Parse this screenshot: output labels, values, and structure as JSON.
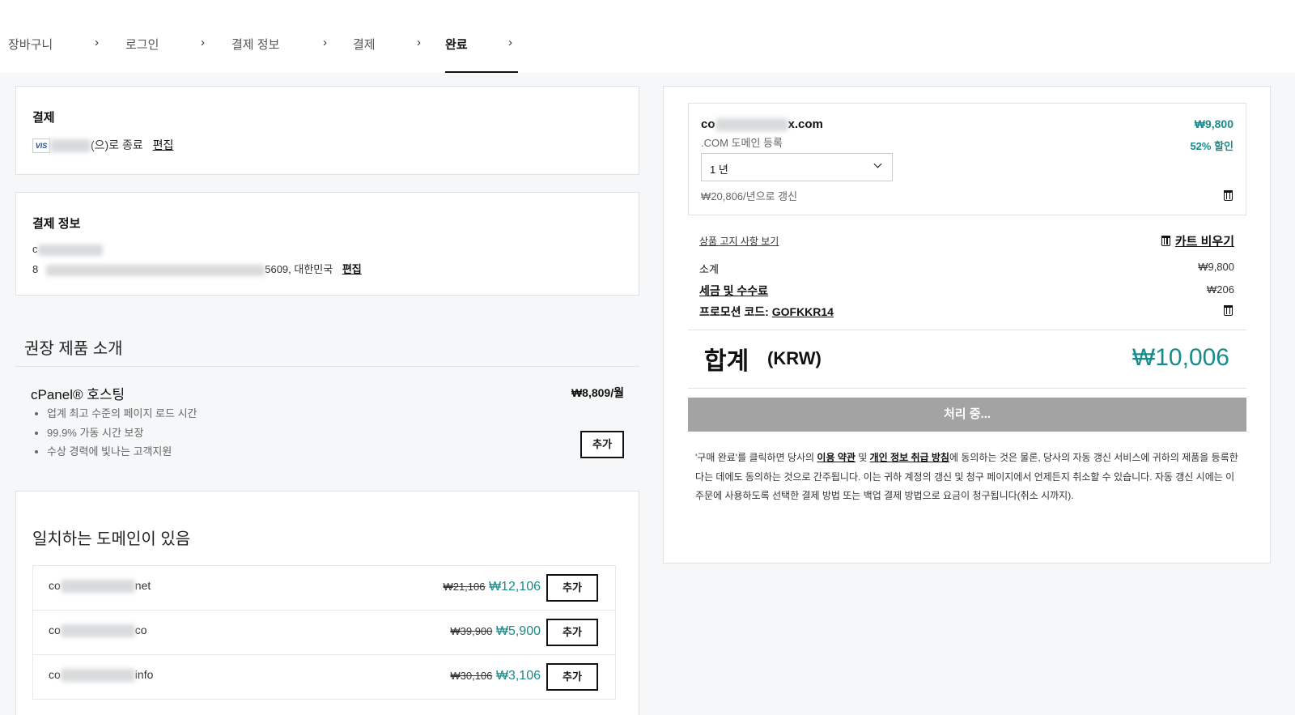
{
  "breadcrumb": {
    "steps": [
      "장바구니",
      "로그인",
      "결제 정보",
      "결제",
      "완료"
    ],
    "separator": "›"
  },
  "payment": {
    "title": "결제",
    "card_brand": "VIS",
    "card_suffix": "(으)로 종료",
    "edit_label": "편집"
  },
  "billing": {
    "title": "결제 정보",
    "name_prefix": "c",
    "address_prefix": "8",
    "address_suffix": "5609, 대한민국",
    "edit_label": "편집"
  },
  "recommended": {
    "title": "권장 제품 소개",
    "product": {
      "name": "cPanel® 호스팅",
      "price": "₩8,809/월",
      "features": [
        "업계 최고 수준의 페이지 로드 시간",
        "99.9% 가동 시간 보장",
        "수상 경력에 빛나는 고객지원"
      ],
      "add_label": "추가"
    }
  },
  "matching": {
    "title": "일치하는 도메인이 있음",
    "rows": [
      {
        "prefix": "co",
        "suffix": "net",
        "old_price": "₩21,106",
        "new_price": "₩12,106",
        "add_label": "추가"
      },
      {
        "prefix": "co",
        "suffix": "co",
        "old_price": "₩39,900",
        "new_price": "₩5,900",
        "add_label": "추가"
      },
      {
        "prefix": "co",
        "suffix": "info",
        "old_price": "₩30,106",
        "new_price": "₩3,106",
        "add_label": "추가"
      }
    ]
  },
  "cart": {
    "item": {
      "domain_prefix": "co",
      "domain_suffix": "x.com",
      "subtitle": ".COM 도메인 등록",
      "price": "₩9,800",
      "discount": "52% 할인",
      "term_value": "1 년",
      "renewal": "₩20,806/년으로 갱신"
    },
    "notice_link": "상품 고지 사항 보기",
    "empty_cart": "카트 비우기",
    "subtotal_label": "소계",
    "subtotal_value": "₩9,800",
    "tax_label": "세금 및 수수료",
    "tax_value": "₩206",
    "promo_label": "프로모션 코드: ",
    "promo_code": "GOFKKR14",
    "total_label": "합계",
    "total_currency": "(KRW)",
    "total_value": "₩10,006",
    "processing_label": "처리 중...",
    "legal_1": "'구매 완료'를 클릭하면 당사의 ",
    "legal_terms": "이용 약관",
    "legal_and": " 및 ",
    "legal_privacy": "개인 정보 취급 방침",
    "legal_2": "에 동의하는 것은 물론, 당사의 자동 갱신 서비스에 귀하의 제품을 등록한다는 데에도 동의하는 것으로 간주됩니다. 이는 귀하 계정의 갱신 및 청구 페이지에서 언제든지 취소할 수 있습니다. 자동 갱신 시에는 이 주문에 사용하도록 선택한 결제 방법 또는 백업 결제 방법으로 요금이 청구됩니다(취소 시까지)."
  },
  "colors": {
    "accent": "#1b8a8a",
    "processing_bg": "#a3a3a3"
  }
}
